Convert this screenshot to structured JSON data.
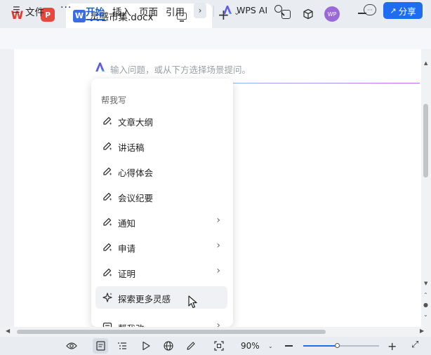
{
  "titlebar": {
    "wps_logo": "W",
    "pdf_logo": "P",
    "tab_name": "灵感市集.docx",
    "tab_icon": "W",
    "close_glyph": "✕",
    "new_tab_glyph": "+",
    "new_tab_caret": "⌄",
    "avatar_text": "WP",
    "win_close_glyph": "✕"
  },
  "ribbon": {
    "menu_glyph": "☰",
    "file": "文件",
    "more": "···",
    "start": "开始",
    "insert": "插入",
    "page": "页面",
    "reference": "引用",
    "expand": "›",
    "ai_label": "WPS AI",
    "chat_glyph": "···",
    "share": "分享",
    "share_icon": "↗"
  },
  "ai_input": {
    "placeholder": "输入问题，或从下方选择场景提问。"
  },
  "dropdown": {
    "header": "帮我写",
    "items": [
      {
        "label": "文章大纲",
        "has_submenu": false
      },
      {
        "label": "讲话稿",
        "has_submenu": false
      },
      {
        "label": "心得体会",
        "has_submenu": false
      },
      {
        "label": "会议纪要",
        "has_submenu": false
      },
      {
        "label": "通知",
        "has_submenu": true
      },
      {
        "label": "申请",
        "has_submenu": true
      },
      {
        "label": "证明",
        "has_submenu": true
      },
      {
        "label": "探索更多灵感",
        "has_submenu": false,
        "hovered": true
      },
      {
        "label": "帮我改",
        "has_submenu": true
      }
    ],
    "chevron": "›"
  },
  "statusbar": {
    "zoom": "90%",
    "zoom_caret": "⌄",
    "zoom_fraction": 0.45,
    "plus": "+",
    "fit_glyph": "⤢"
  },
  "colors": {
    "accent": "#1e6cf0",
    "ai_purple": "#5e5ce6",
    "wps_red": "#e33a2d"
  }
}
